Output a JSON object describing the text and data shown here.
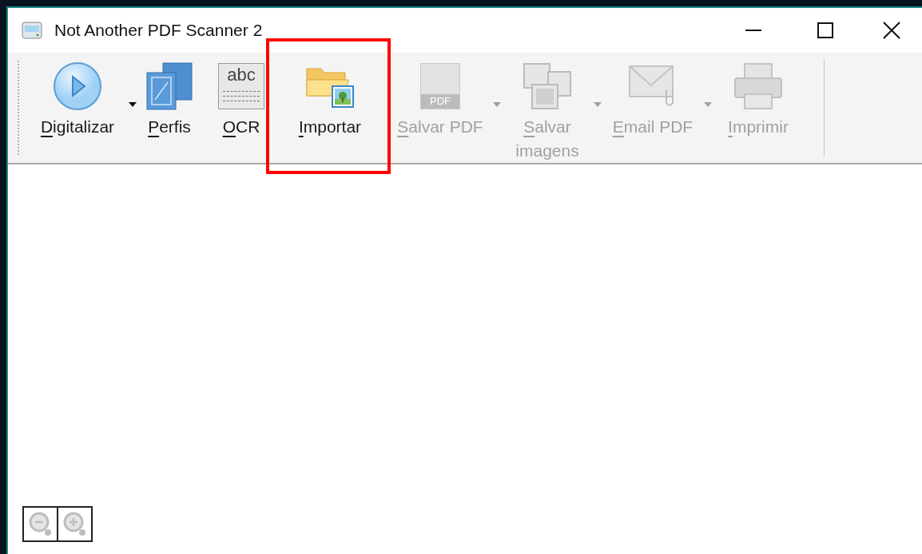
{
  "window": {
    "title": "Not Another PDF Scanner 2"
  },
  "toolbar": [
    {
      "kind": "scan",
      "label": "Digitalizar",
      "disabled": false,
      "dropdown": true,
      "highlighted": false
    },
    {
      "kind": "profiles",
      "label": "Perfis",
      "disabled": false,
      "dropdown": false,
      "highlighted": false
    },
    {
      "kind": "ocr",
      "label": "OCR",
      "icon_text": "abc",
      "disabled": false,
      "dropdown": false,
      "highlighted": false
    },
    {
      "kind": "import",
      "label": "Importar",
      "disabled": false,
      "dropdown": false,
      "highlighted": true
    },
    {
      "kind": "pdf",
      "label": "Salvar PDF",
      "icon_text": "PDF",
      "disabled": true,
      "dropdown": true,
      "highlighted": false
    },
    {
      "kind": "images",
      "label": "Salvar imagens",
      "disabled": true,
      "dropdown": true,
      "highlighted": false
    },
    {
      "kind": "email",
      "label": "Email PDF",
      "disabled": true,
      "dropdown": true,
      "highlighted": false
    },
    {
      "kind": "print",
      "label": "Imprimir",
      "disabled": true,
      "dropdown": false,
      "highlighted": false
    }
  ],
  "zoom_controls": [
    {
      "kind": "zoom_out",
      "disabled": true
    },
    {
      "kind": "zoom_in",
      "disabled": true
    }
  ]
}
